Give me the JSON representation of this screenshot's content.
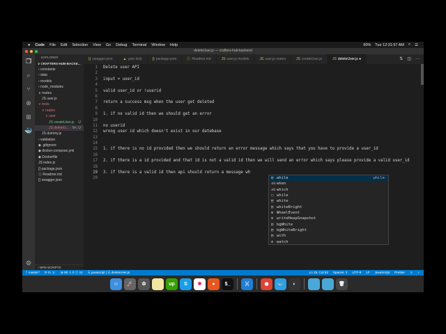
{
  "menubar": {
    "apple": "",
    "items": [
      "Code",
      "File",
      "Edit",
      "Selection",
      "View",
      "Go",
      "Debug",
      "Terminal",
      "Window",
      "Help"
    ],
    "battery": "90%",
    "clock": "Tue 12:31:57 AM"
  },
  "window": {
    "title": "deleteUser.js — crafters-hub-backend"
  },
  "tabs": [
    {
      "icon": "{}",
      "label": "swagger.json"
    },
    {
      "icon": "▲",
      "label": "yarn.lock"
    },
    {
      "icon": "{}",
      "label": "package.json"
    },
    {
      "icon": "ⓘ",
      "label": "Readme.md"
    },
    {
      "icon": "JS",
      "label": "user.js models"
    },
    {
      "icon": "JS",
      "label": "user.js routes"
    },
    {
      "icon": "JS",
      "label": "createUser.js"
    },
    {
      "icon": "JS",
      "label": "deleteUser.js ●",
      "active": true
    }
  ],
  "sidebar": {
    "title": "EXPLORER",
    "root": "∨ CRAFTERS-HUB-BACKE...",
    "tree": [
      {
        "label": "› constants",
        "indent": 1
      },
      {
        "label": "› data",
        "indent": 1
      },
      {
        "label": "› models",
        "indent": 1
      },
      {
        "label": "› node_modules",
        "indent": 1
      },
      {
        "label": "∨ routes",
        "indent": 1
      },
      {
        "label": "JS user.js",
        "indent": 2
      },
      {
        "label": "∨ tests",
        "indent": 1,
        "color": "#e06c75"
      },
      {
        "label": "∨ routes",
        "indent": 2,
        "color": "#e06c75"
      },
      {
        "label": "∨ user",
        "indent": 3,
        "color": "#e06c75"
      },
      {
        "label": "JS createUser.js",
        "indent": 4,
        "color": "#73c991",
        "badge": "U"
      },
      {
        "label": "JS deleteU...",
        "indent": 4,
        "color": "#e06c75",
        "badge": "9+, U",
        "sel": true
      },
      {
        "label": "JS dummy.js",
        "indent": 2
      },
      {
        "label": "› validation",
        "indent": 1
      },
      {
        "label": "◆ .gitignore",
        "indent": 1
      },
      {
        "label": "◆ docker-compose.yml",
        "indent": 1
      },
      {
        "label": "◆ Dockerfile",
        "indent": 1
      },
      {
        "label": "JS index.js",
        "indent": 1
      },
      {
        "label": "{} package.json",
        "indent": 1
      },
      {
        "label": "ⓘ Readme.md",
        "indent": 1
      },
      {
        "label": "{} swagger.json",
        "indent": 1
      }
    ],
    "npm": "› NPM SCRIPTS"
  },
  "editor": {
    "lines": [
      "Delete user API",
      "",
      "input = user_id",
      "",
      "valid user_id or !userid",
      "",
      "return a success msg when the user get deleted",
      "",
      "1. if no valid id then we should get an error",
      "",
      "no userid",
      "wrong user id which doesn't exist in our datebase",
      "",
      "",
      "1. if there is no id provided then we should return an error message which says that you have to provide a user_id",
      "",
      "2. if there is a id provided and that id is not a valid id then we will send an error which says please provide a valid user_id",
      "",
      "3. if there is a valid id then api should return a message wh",
      ""
    ]
  },
  "suggest": [
    {
      "icon": "▤",
      "label": "while",
      "detail": "while"
    },
    {
      "icon": "ab",
      "label": "when"
    },
    {
      "icon": "ab",
      "label": "which"
    },
    {
      "icon": "□",
      "label": "while"
    },
    {
      "icon": "▤",
      "label": "white"
    },
    {
      "icon": "▤",
      "label": "whiteBright"
    },
    {
      "icon": "⊠",
      "label": "WheelEvent"
    },
    {
      "icon": "⊛",
      "label": "writeHeapSnapshot"
    },
    {
      "icon": "▤",
      "label": "bgWhite"
    },
    {
      "icon": "▤",
      "label": "bgWhiteBright"
    },
    {
      "icon": "▤",
      "label": "with"
    },
    {
      "icon": "⊛",
      "label": "watch"
    }
  ],
  "status": {
    "branch": "ᚠ master*",
    "sync": "⟳ 0↓ 1↑",
    "problems": "⊗ 90 ⚠ 0 ⓘ 12",
    "context": "☰ javascript | ☰ deleteUser.js",
    "position": "Ln 19, Col 62",
    "spaces": "Spaces: 2",
    "encoding": "UTF-8",
    "eol": "LF",
    "language": "JavaScript",
    "formatter": "Prettier"
  },
  "dock": [
    {
      "name": "finder",
      "label": "☺",
      "color": "#3d8fe0"
    },
    {
      "name": "launchpad",
      "label": "🚀",
      "color": "#666"
    },
    {
      "name": "system-preferences",
      "label": "⚙",
      "color": "#555"
    },
    {
      "name": "notes",
      "label": "",
      "color": "#f3e6a0"
    },
    {
      "name": "upwork",
      "label": "up",
      "color": "#37a000"
    },
    {
      "name": "skype",
      "label": "S",
      "color": "#1a9ee8"
    },
    {
      "name": "slack",
      "label": "✱",
      "color": "#fff"
    },
    {
      "name": "firefox",
      "label": "●",
      "color": "#e8561f"
    },
    {
      "name": "terminal",
      "label": "$_",
      "color": "#111"
    },
    {
      "sep": true
    },
    {
      "name": "vscode",
      "label": "⟩⟨",
      "color": "#1f7fd4"
    },
    {
      "sep": true
    },
    {
      "name": "chrome",
      "label": "◉",
      "color": "#dd4433"
    },
    {
      "name": "docker",
      "label": "🐳",
      "color": "#2aa0e8"
    },
    {
      "name": "quicktime",
      "label": "◐",
      "color": "#333"
    },
    {
      "sep": true
    },
    {
      "name": "folder",
      "label": "",
      "color": "#4aa8d8"
    },
    {
      "name": "downloads",
      "label": "",
      "color": "#4aa8d8"
    },
    {
      "name": "trash",
      "label": "🗑",
      "color": "#444"
    }
  ]
}
